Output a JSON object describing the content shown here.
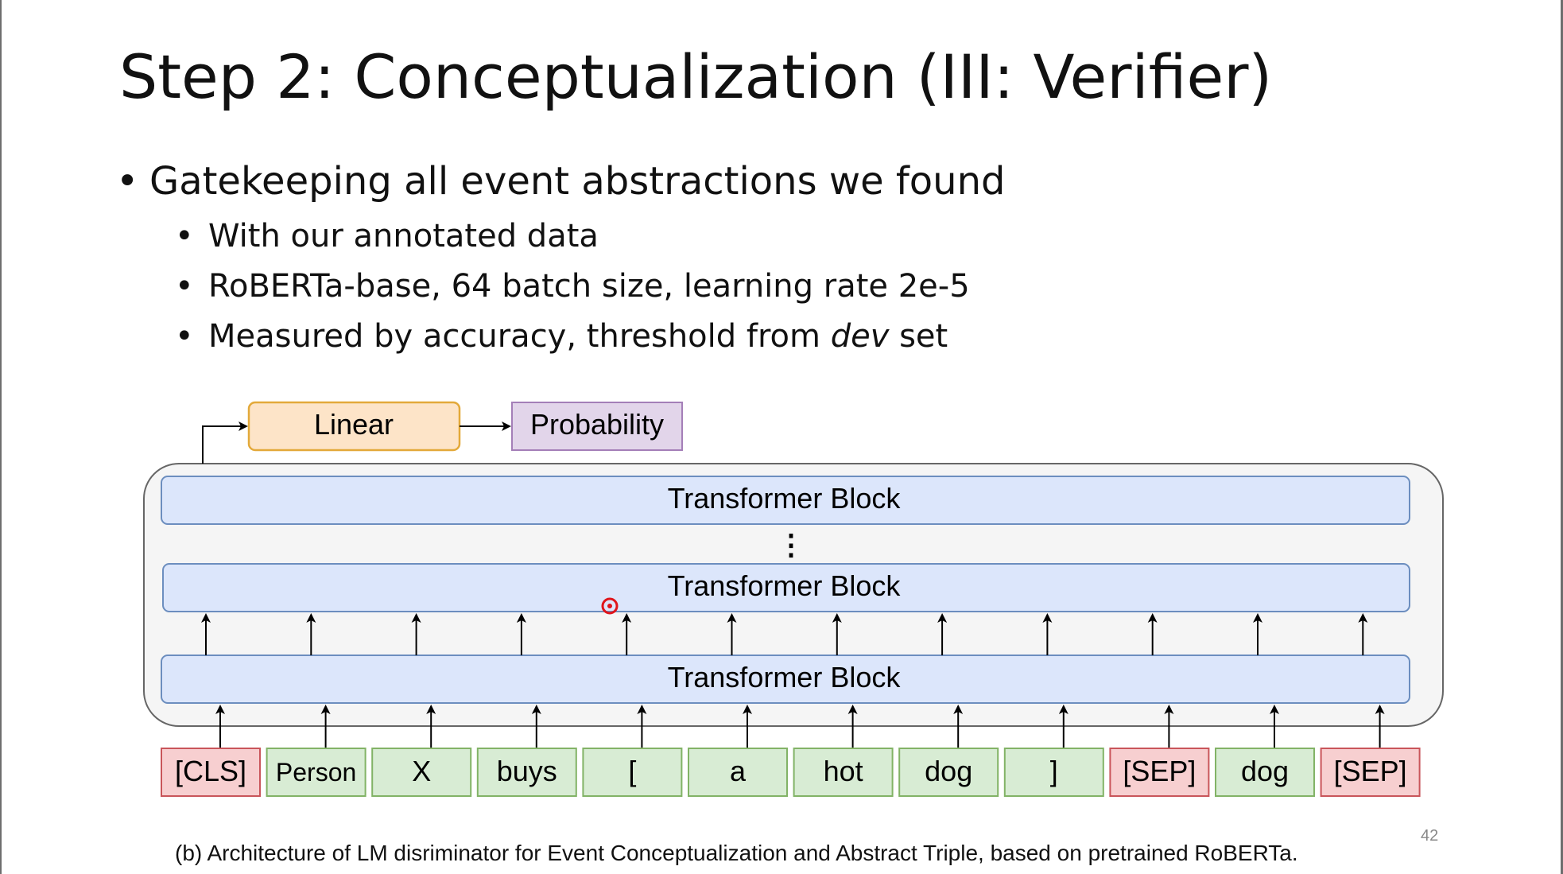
{
  "slide": {
    "title": "Step 2: Conceptualization (III: Verifier)",
    "bullets": [
      {
        "text": "Gatekeeping all event abstractions we found",
        "level": 1
      },
      {
        "text": "With our annotated data",
        "level": 2
      },
      {
        "text": "RoBERTa-base, 64 batch size, learning rate 2e-5",
        "level": 2
      },
      {
        "text_before": "Measured by accuracy, threshold from ",
        "text_italic": "dev",
        "text_after": " set",
        "level": 2
      }
    ],
    "bullet_glyph": "•",
    "page_number": "42"
  },
  "diagram": {
    "head": {
      "linear_label": "Linear",
      "probability_label": "Probability"
    },
    "transformer_blocks": [
      "Transformer Block",
      "Transformer Block",
      "Transformer Block"
    ],
    "ellipsis": "⋮",
    "tokens": [
      {
        "text": "[CLS]",
        "kind": "special"
      },
      {
        "text": "Person",
        "kind": "word"
      },
      {
        "text": "X",
        "kind": "word"
      },
      {
        "text": "buys",
        "kind": "word"
      },
      {
        "text": "[",
        "kind": "word"
      },
      {
        "text": "a",
        "kind": "word"
      },
      {
        "text": "hot",
        "kind": "word"
      },
      {
        "text": "dog",
        "kind": "word"
      },
      {
        "text": "]",
        "kind": "word"
      },
      {
        "text": "[SEP]",
        "kind": "special"
      },
      {
        "text": "dog",
        "kind": "word"
      },
      {
        "text": "[SEP]",
        "kind": "special"
      }
    ],
    "caption": "(b) Architecture of LM disriminator for Event Conceptualization and Abstract Triple, based on pretrained RoBERTa.",
    "colors": {
      "linear_fill": "#fde4c8",
      "linear_stroke": "#e3a93a",
      "prob_fill": "#e2d5ea",
      "prob_stroke": "#a47fb8",
      "block_fill": "#dce6fb",
      "block_stroke": "#6c8ebf",
      "container_fill": "#f5f5f5",
      "container_stroke": "#666666",
      "special_fill": "#f7cfd0",
      "special_stroke": "#c9555a",
      "word_fill": "#d8ecd4",
      "word_stroke": "#82b366",
      "pointer_dot": "#e0151b"
    }
  }
}
